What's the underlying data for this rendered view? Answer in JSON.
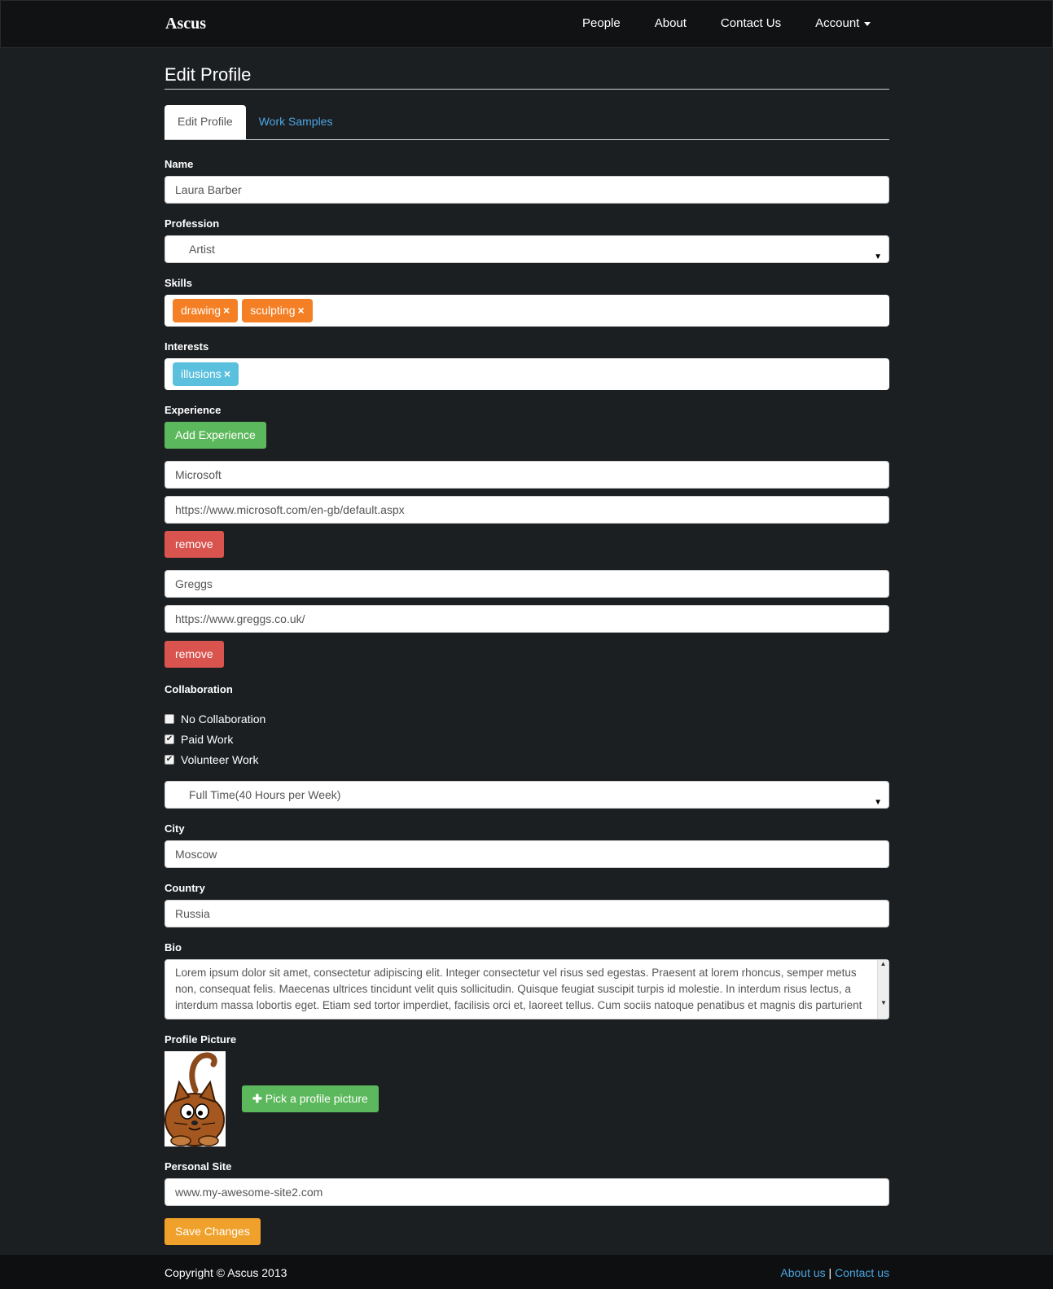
{
  "nav": {
    "brand": "Ascus",
    "links": [
      "People",
      "About",
      "Contact Us",
      "Account"
    ]
  },
  "page": {
    "title": "Edit Profile"
  },
  "tabs": {
    "edit_profile": "Edit Profile",
    "work_samples": "Work Samples"
  },
  "form": {
    "name": {
      "label": "Name",
      "value": "Laura Barber"
    },
    "profession": {
      "label": "Profession",
      "value": "Artist"
    },
    "skills": {
      "label": "Skills",
      "tags": [
        "drawing",
        "sculpting"
      ]
    },
    "interests": {
      "label": "Interests",
      "tags": [
        "illusions"
      ]
    },
    "experience": {
      "label": "Experience",
      "add_label": "Add Experience",
      "remove_label": "remove",
      "entries": [
        {
          "company": "Microsoft",
          "url": "https://www.microsoft.com/en-gb/default.aspx"
        },
        {
          "company": "Greggs",
          "url": "https://www.greggs.co.uk/"
        }
      ]
    },
    "collaboration": {
      "label": "Collaboration",
      "options": [
        {
          "label": "No Collaboration",
          "checked": false
        },
        {
          "label": "Paid Work",
          "checked": true
        },
        {
          "label": "Volunteer Work",
          "checked": true
        }
      ],
      "availability": "Full Time(40 Hours per Week)"
    },
    "city": {
      "label": "City",
      "value": "Moscow"
    },
    "country": {
      "label": "Country",
      "value": "Russia"
    },
    "bio": {
      "label": "Bio",
      "value": "Lorem ipsum dolor sit amet, consectetur adipiscing elit. Integer consectetur vel risus sed egestas. Praesent at lorem rhoncus, semper metus non, consequat felis. Maecenas ultrices tincidunt velit quis sollicitudin. Quisque feugiat suscipit turpis id molestie. In interdum risus lectus, a interdum massa lobortis eget. Etiam sed tortor imperdiet, facilisis orci et, laoreet tellus. Cum sociis natoque penatibus et magnis dis parturient"
    },
    "picture": {
      "label": "Profile Picture",
      "button": "Pick a profile picture"
    },
    "site": {
      "label": "Personal Site",
      "value": "www.my-awesome-site2.com"
    },
    "save": "Save Changes"
  },
  "footer": {
    "copyright": "Copyright © Ascus 2013",
    "about": "About us",
    "separator": "|",
    "contact": "Contact us"
  },
  "colors": {
    "accent_blue": "#4ba6e2",
    "green": "#5cb85c",
    "red": "#d9534f",
    "orange": "#f0a12b",
    "tag_orange": "#f47f24",
    "tag_blue": "#5bc0de"
  }
}
